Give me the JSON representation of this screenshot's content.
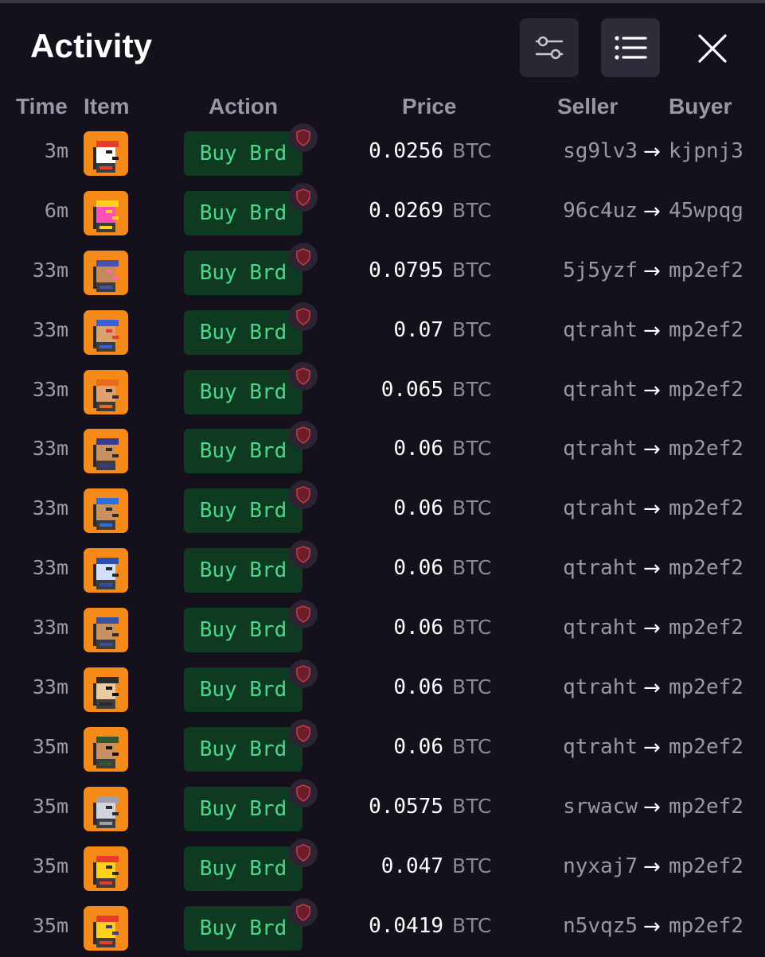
{
  "header": {
    "title": "Activity",
    "filter_icon": "sliders-icon",
    "list_icon": "list-icon",
    "close_icon": "close-icon"
  },
  "columns": {
    "time": "Time",
    "item": "Item",
    "action": "Action",
    "price": "Price",
    "seller": "Seller",
    "buyer": "Buyer"
  },
  "colors": {
    "background": "#15111c",
    "action_bg": "#0f3a22",
    "action_text": "#4bd88a",
    "avatar_bg": "#f58a18",
    "shield": "#b5303e"
  },
  "rows": [
    {
      "time": "3m",
      "action": "Buy Brd",
      "price": "0.0256",
      "unit": "BTC",
      "seller": "sg9lv3",
      "buyer": "kjpnj3"
    },
    {
      "time": "6m",
      "action": "Buy Brd",
      "price": "0.0269",
      "unit": "BTC",
      "seller": "96c4uz",
      "buyer": "45wpqg"
    },
    {
      "time": "33m",
      "action": "Buy Brd",
      "price": "0.0795",
      "unit": "BTC",
      "seller": "5j5yzf",
      "buyer": "mp2ef2"
    },
    {
      "time": "33m",
      "action": "Buy Brd",
      "price": "0.07",
      "unit": "BTC",
      "seller": "qtraht",
      "buyer": "mp2ef2"
    },
    {
      "time": "33m",
      "action": "Buy Brd",
      "price": "0.065",
      "unit": "BTC",
      "seller": "qtraht",
      "buyer": "mp2ef2"
    },
    {
      "time": "33m",
      "action": "Buy Brd",
      "price": "0.06",
      "unit": "BTC",
      "seller": "qtraht",
      "buyer": "mp2ef2"
    },
    {
      "time": "33m",
      "action": "Buy Brd",
      "price": "0.06",
      "unit": "BTC",
      "seller": "qtraht",
      "buyer": "mp2ef2"
    },
    {
      "time": "33m",
      "action": "Buy Brd",
      "price": "0.06",
      "unit": "BTC",
      "seller": "qtraht",
      "buyer": "mp2ef2"
    },
    {
      "time": "33m",
      "action": "Buy Brd",
      "price": "0.06",
      "unit": "BTC",
      "seller": "qtraht",
      "buyer": "mp2ef2"
    },
    {
      "time": "33m",
      "action": "Buy Brd",
      "price": "0.06",
      "unit": "BTC",
      "seller": "qtraht",
      "buyer": "mp2ef2"
    },
    {
      "time": "35m",
      "action": "Buy Brd",
      "price": "0.06",
      "unit": "BTC",
      "seller": "qtraht",
      "buyer": "mp2ef2"
    },
    {
      "time": "35m",
      "action": "Buy Brd",
      "price": "0.0575",
      "unit": "BTC",
      "seller": "srwacw",
      "buyer": "mp2ef2"
    },
    {
      "time": "35m",
      "action": "Buy Brd",
      "price": "0.047",
      "unit": "BTC",
      "seller": "nyxaj7",
      "buyer": "mp2ef2"
    },
    {
      "time": "35m",
      "action": "Buy Brd",
      "price": "0.0419",
      "unit": "BTC",
      "seller": "n5vqz5",
      "buyer": "mp2ef2"
    }
  ]
}
